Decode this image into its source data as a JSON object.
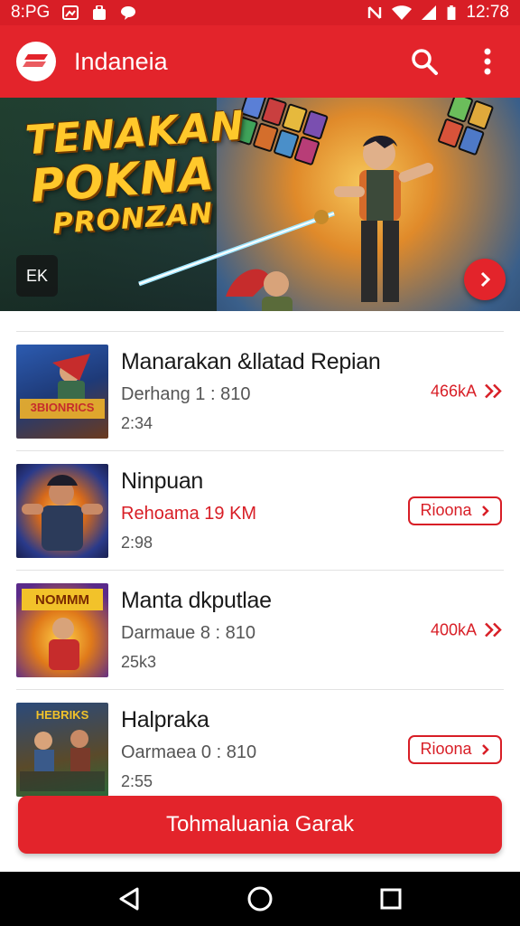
{
  "status_bar": {
    "left_text": "8:PG",
    "time": "12:78",
    "icons": [
      "image-icon",
      "bag-icon",
      "chat-icon",
      "nfc-icon",
      "wifi-icon",
      "signal-icon",
      "battery-icon"
    ]
  },
  "app_bar": {
    "title": "Indaneia",
    "icons": [
      "app-logo-icon",
      "search-icon",
      "more-vert-icon"
    ]
  },
  "banner": {
    "line1": "TENAKAN",
    "line2": "POKNA",
    "line3": "PRONZAN",
    "badge": "EK",
    "icons": [
      "chevron-right-icon"
    ]
  },
  "items": [
    {
      "title": "Manarakan &llatad Repian",
      "meta": "Derhang 1 : 810",
      "duration": "2:34",
      "action": "466kA",
      "action_type": "text",
      "thumb_text": "3BIONRICS"
    },
    {
      "title": "Ninpuan",
      "meta": "Rehoama 19 KM",
      "duration": "2:98",
      "action": "Rioona",
      "action_type": "button",
      "thumb_text": ""
    },
    {
      "title": "Manta dkputlae",
      "meta": "Darmaue 8 : 810",
      "duration": "25k3",
      "action": "400kA",
      "action_type": "text",
      "thumb_text": "NOMMM"
    },
    {
      "title": "Halpraka",
      "meta": "Oarmaea 0 : 810",
      "duration": "2:55",
      "action": "Rioona",
      "action_type": "button",
      "thumb_text": "HEBRIKS"
    }
  ],
  "cta": {
    "label": "Tohmaluania Garak"
  },
  "nav_bar": {
    "icons": [
      "back-icon",
      "home-icon",
      "recents-icon"
    ]
  },
  "colors": {
    "accent": "#e3242b",
    "status": "#d81e26",
    "text": "#1a1a1a",
    "muted": "#555555",
    "divider": "#e2e2e2"
  }
}
